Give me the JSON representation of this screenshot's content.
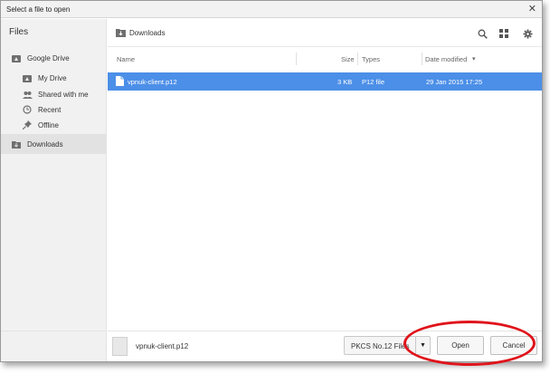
{
  "window": {
    "title": "Select a file to open",
    "close_glyph": "✕"
  },
  "sidebar": {
    "heading": "Files",
    "items": [
      {
        "label": "Google Drive",
        "icon": "drive-icon"
      },
      {
        "label": "My Drive",
        "icon": "my-drive-icon"
      },
      {
        "label": "Shared with me",
        "icon": "shared-icon"
      },
      {
        "label": "Recent",
        "icon": "clock-icon"
      },
      {
        "label": "Offline",
        "icon": "pin-icon"
      },
      {
        "label": "Downloads",
        "icon": "downloads-icon"
      }
    ]
  },
  "toolbar": {
    "breadcrumb": "Downloads",
    "search_icon": "search-icon",
    "grid_icon": "grid-view-icon",
    "settings_icon": "gear-icon"
  },
  "columns": {
    "name": "Name",
    "size": "Size",
    "type": "Types",
    "date": "Date modified",
    "sort_glyph": "▾"
  },
  "files": [
    {
      "name": "vpnuk-client.p12",
      "size": "3 KB",
      "type": "P12 file",
      "date": "29 Jan 2015 17:25"
    }
  ],
  "footer": {
    "filename": "vpnuk-client.p12",
    "file_type": "PKCS No.12 Files",
    "dropdown_glyph": "▼",
    "open_label": "Open",
    "cancel_label": "Cancel"
  },
  "colors": {
    "selection": "#4c8fe8",
    "annotation": "#e0141b"
  }
}
